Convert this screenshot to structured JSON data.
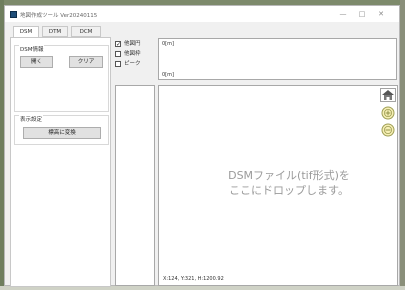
{
  "window": {
    "title": "地図作成ツール Ver20240115",
    "controls": {
      "minimize": "—",
      "maximize": "□",
      "close": "✕"
    }
  },
  "tabs": [
    "DSM",
    "DTM",
    "DCM"
  ],
  "active_tab": "DSM",
  "dsm_group": {
    "label": "DSM情報",
    "open_label": "開く",
    "clear_label": "クリア"
  },
  "display_group": {
    "label": "表示設定",
    "convert_label": "標高に変換"
  },
  "checkboxes": [
    {
      "label": "他図円",
      "checked": true
    },
    {
      "label": "他図枠",
      "checked": false
    },
    {
      "label": "ピーク",
      "checked": false
    }
  ],
  "profile": {
    "top_label": "0[m]",
    "bottom_label": "0[m]"
  },
  "map": {
    "drop_line1": "DSMファイル(tif形式)を",
    "drop_line2": "ここにドロップします。",
    "status": "X:124, Y:321, H:1200.92"
  },
  "tools": [
    "map-layer-icon",
    "zoom-in-icon",
    "zoom-out-icon"
  ],
  "colors": {
    "icon_fill": "#f6efb4",
    "icon_stroke": "#9d9d55",
    "app_icon": "#1f4e79"
  }
}
